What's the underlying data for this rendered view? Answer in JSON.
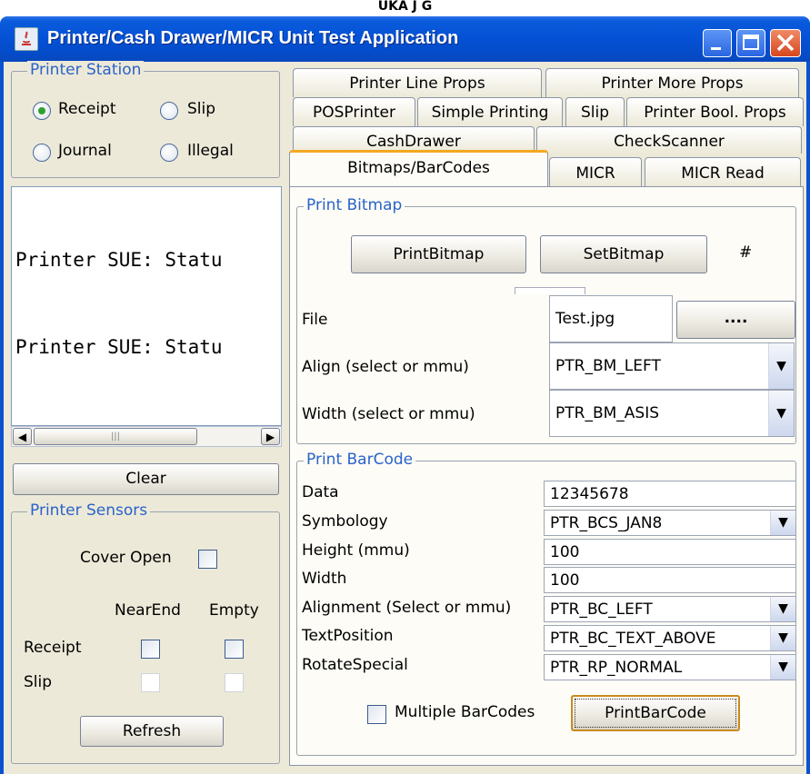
{
  "top_caption": "UKA J G",
  "window": {
    "title": "Printer/Cash Drawer/MICR Unit Test Application",
    "buttons": {
      "minimize": "_",
      "maximize": "□",
      "close": "X"
    }
  },
  "printer_station": {
    "legend": "Printer Station",
    "options": [
      {
        "label": "Receipt",
        "selected": true
      },
      {
        "label": "Slip",
        "selected": false
      },
      {
        "label": "Journal",
        "selected": false
      },
      {
        "label": "Illegal",
        "selected": false
      }
    ]
  },
  "console": {
    "lines": [
      "Printer SUE: Statu",
      "Printer SUE: Statu"
    ]
  },
  "clear_button": "Clear",
  "printer_sensors": {
    "legend": "Printer Sensors",
    "cover_open_label": "Cover Open",
    "col_nearend": "NearEnd",
    "col_empty": "Empty",
    "row_receipt": "Receipt",
    "row_slip": "Slip",
    "refresh_button": "Refresh"
  },
  "tabs": {
    "row1": [
      "Printer Line Props",
      "Printer More Props"
    ],
    "row2": [
      "POSPrinter",
      "Simple Printing",
      "Slip",
      "Printer Bool. Props"
    ],
    "row3": [
      "CashDrawer",
      "CheckScanner"
    ],
    "row4": [
      "Bitmaps/BarCodes",
      "MICR",
      "MICR Read"
    ],
    "active": "Bitmaps/BarCodes"
  },
  "print_bitmap": {
    "legend": "Print Bitmap",
    "print_bitmap_button": "PrintBitmap",
    "set_bitmap_button": "SetBitmap",
    "hash_label": "#",
    "file_label": "File",
    "file_value": "Test.jpg",
    "browse_button": "....",
    "align_label": "Align (select or mmu)",
    "align_value": "PTR_BM_LEFT",
    "width_label": "Width (select or mmu)",
    "width_value": "PTR_BM_ASIS"
  },
  "print_barcode": {
    "legend": "Print BarCode",
    "data_label": "Data",
    "data_value": "12345678",
    "symbology_label": "Symbology",
    "symbology_value": "PTR_BCS_JAN8",
    "height_label": "Height (mmu)",
    "height_value": "100",
    "width_label": "Width",
    "width_value": "100",
    "alignment_label": "Alignment (Select or mmu)",
    "alignment_value": "PTR_BC_LEFT",
    "textposition_label": "TextPosition",
    "textposition_value": "PTR_BC_TEXT_ABOVE",
    "rotatespecial_label": "RotateSpecial",
    "rotatespecial_value": "PTR_RP_NORMAL",
    "multiple_label": "Multiple BarCodes",
    "print_barcode_button": "PrintBarCode"
  }
}
